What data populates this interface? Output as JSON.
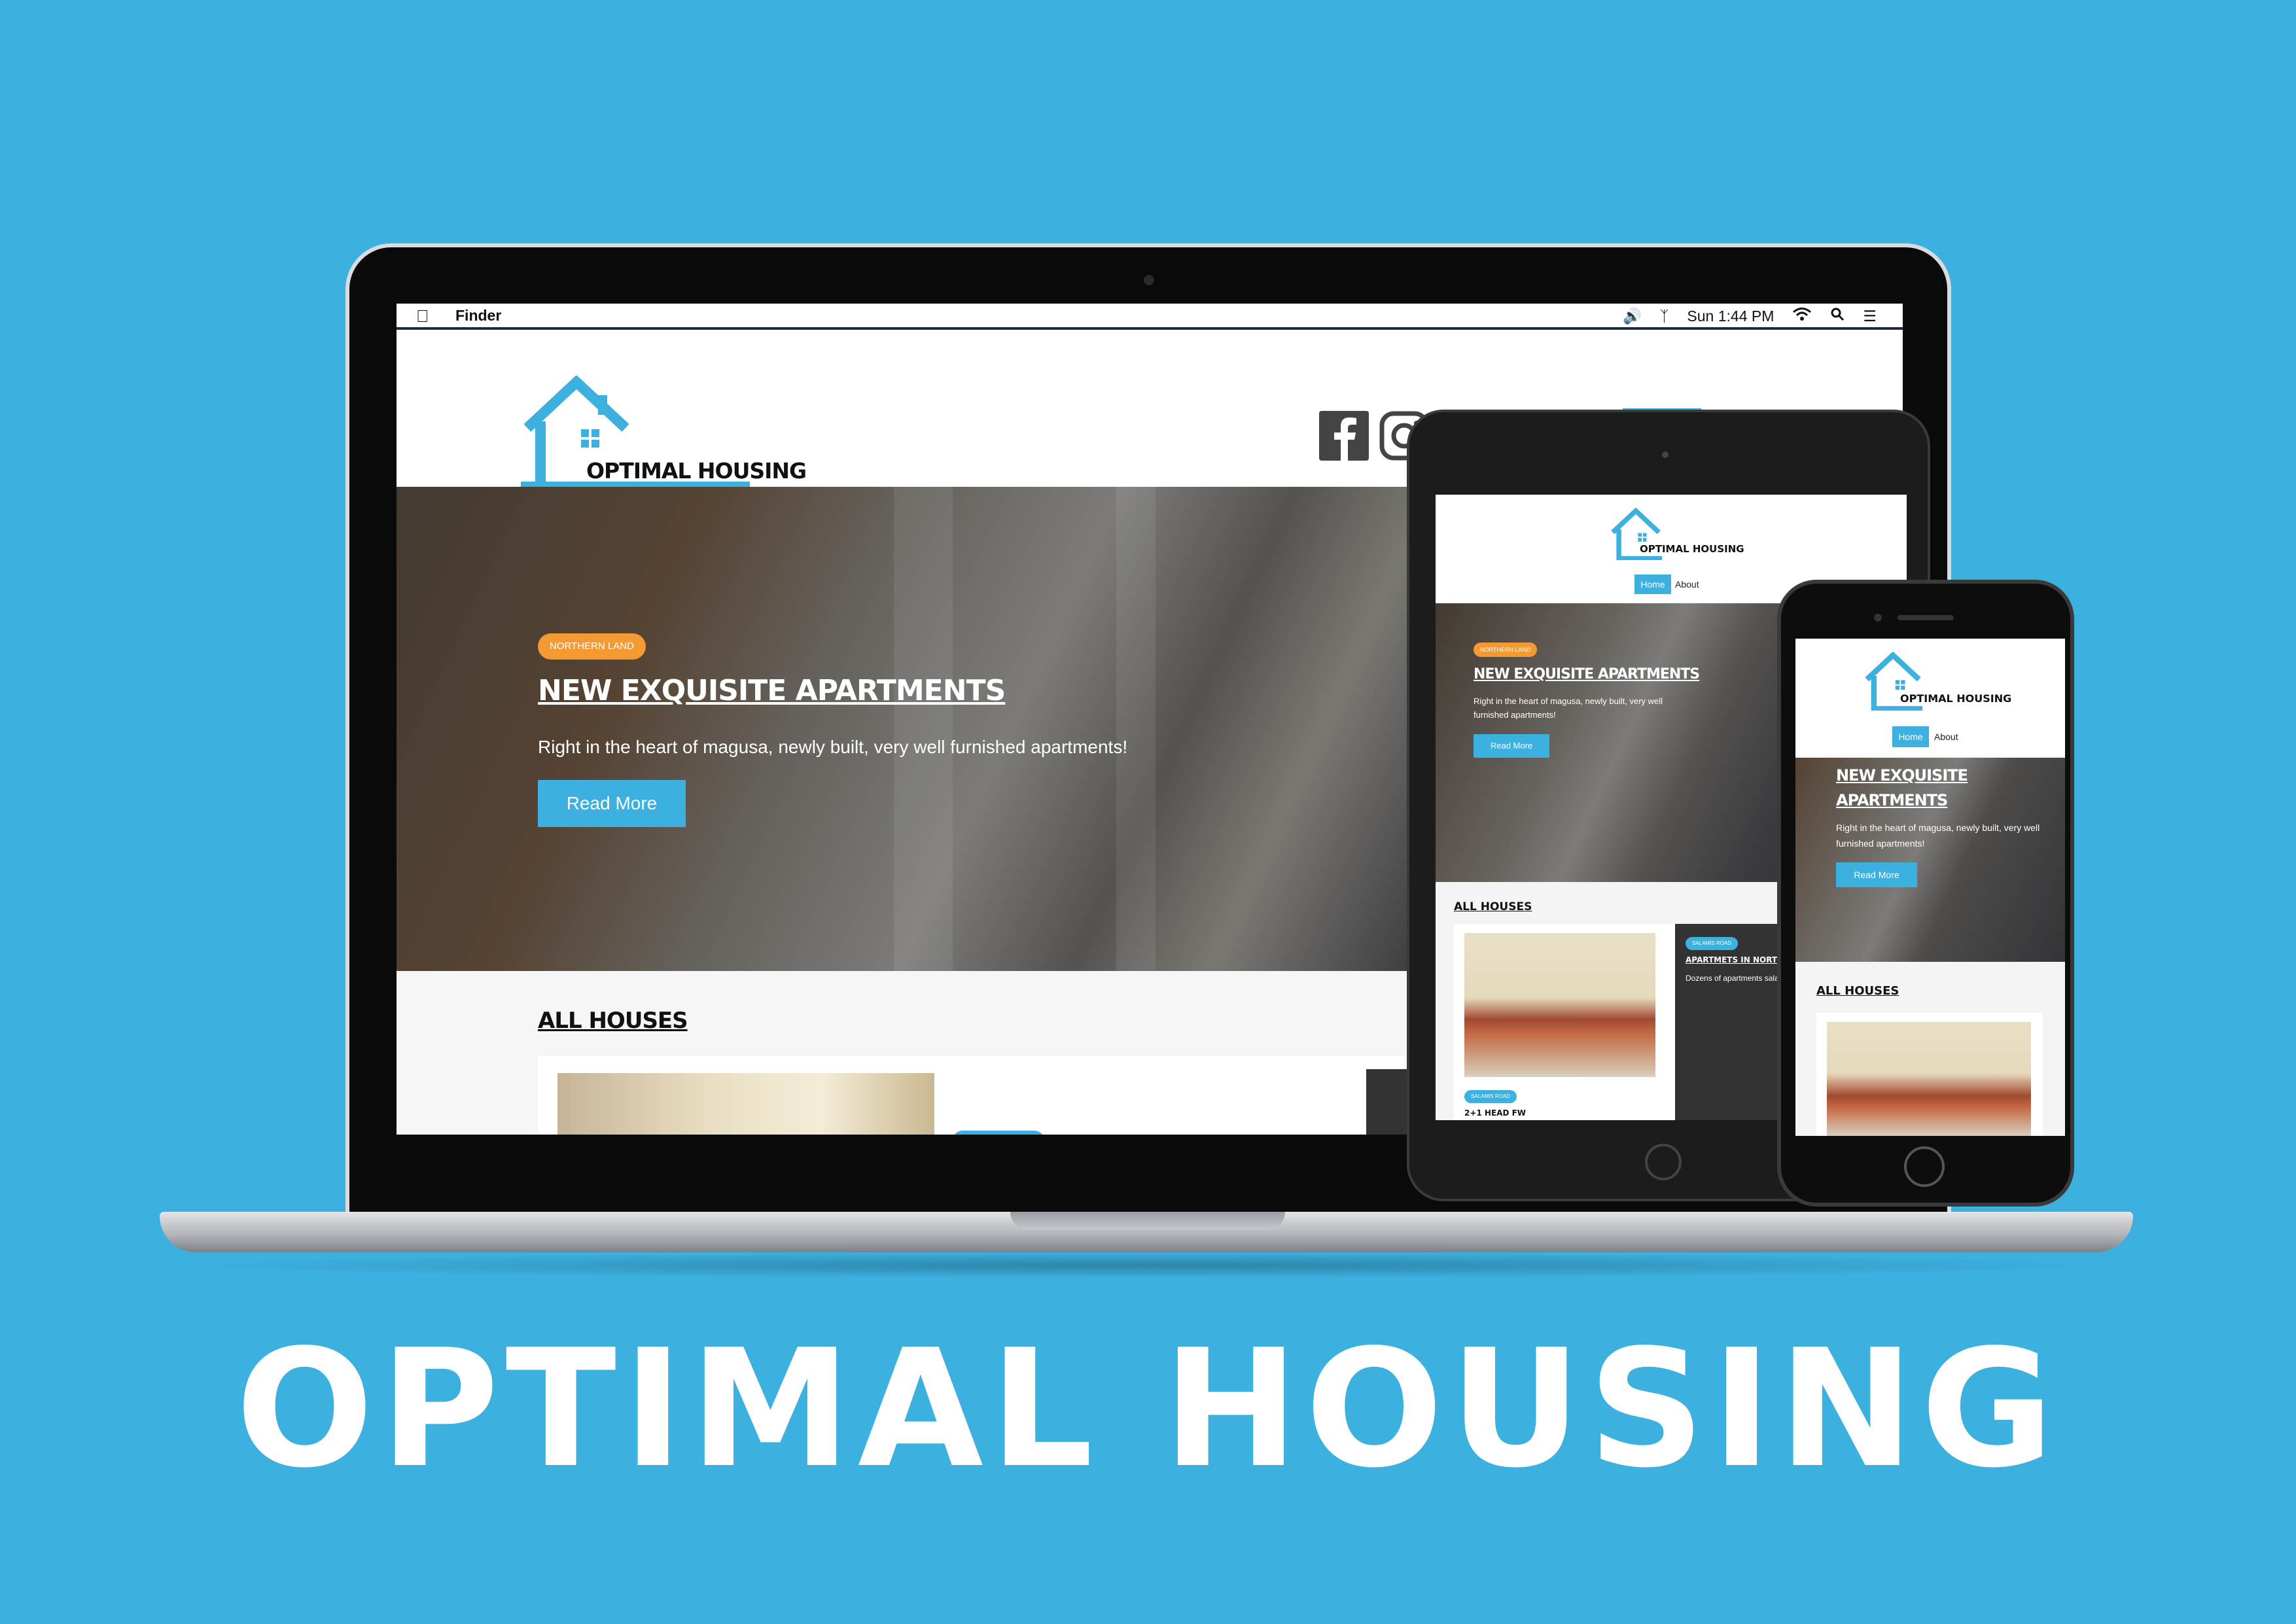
{
  "banner": {
    "title": "OPTIMAL HOUSING"
  },
  "menubar": {
    "app": "Finder",
    "clock": "Sun 1:44 PM",
    "icons": [
      "apple-icon",
      "volume-icon",
      "bluetooth-icon",
      "wifi-icon",
      "spotlight-search-icon",
      "menu-list-icon"
    ]
  },
  "site": {
    "brand": "OPTIMAL HOUSING",
    "nav": {
      "home": "Home",
      "about": "About"
    },
    "social": [
      "facebook-icon",
      "instagram-icon"
    ],
    "hero": {
      "badge": "NORTHERN LAND",
      "title": "NEW EXQUISITE APARTMENTS",
      "text": "Right in the heart of magusa, newly built, very well furnished apartments!",
      "button": "Read More"
    },
    "houses": {
      "title": "ALL HOUSES",
      "card2_badge": "SALAMIS ROAD",
      "card2_title": "APARTMETS IN NORTHERN",
      "card2_text": "Dozens of apartments salamis road at the lo free to contact us any",
      "card3_badge": "SALAMIS ROAD",
      "card3_title": "2+1 HEAD FW"
    }
  },
  "colors": {
    "accent": "#3cb0df",
    "badge": "#f39a33",
    "background": "#3cb0df"
  }
}
